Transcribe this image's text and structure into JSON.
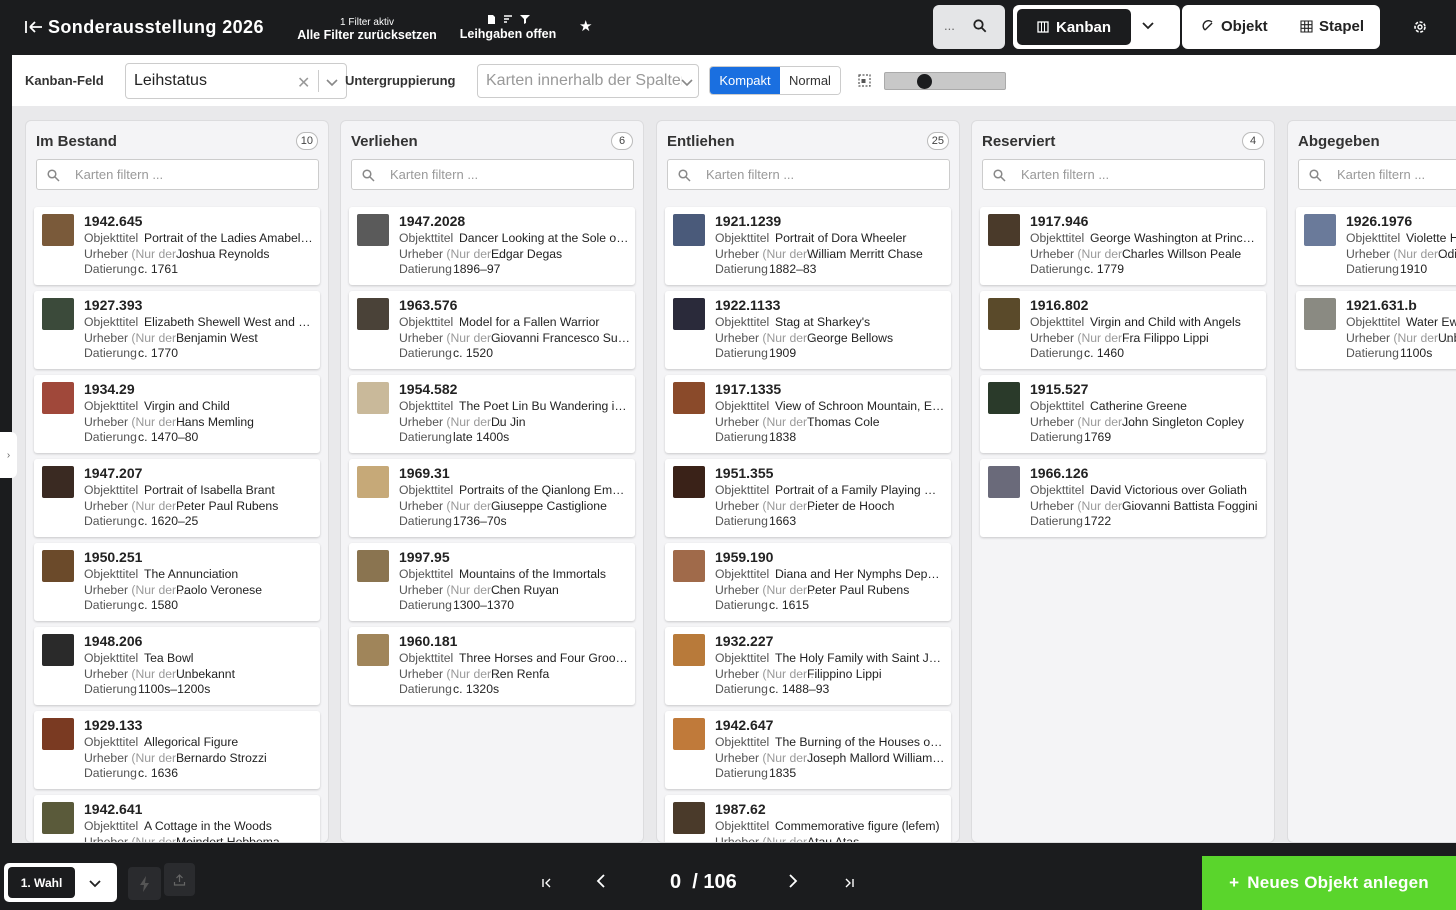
{
  "header": {
    "title": "Sonderausstellung 2026",
    "filter_status": "1 Filter aktiv",
    "filter_reset": "Alle Filter zurücksetzen",
    "lend_filter": "Leihgaben offen",
    "search_dots": "...",
    "view_label": "Kanban",
    "object_label": "Objekt",
    "stack_label": "Stapel"
  },
  "toolbar": {
    "kanban_field_label": "Kanban-Feld",
    "kanban_field_value": "Leihstatus",
    "subgroup_label": "Untergruppierung",
    "subgroup_placeholder": "Karten innerhalb der Spalten",
    "compact_label": "Kompakt",
    "normal_label": "Normal",
    "card_size_level": 0.3
  },
  "card_labels": {
    "title": "Objekttitel",
    "author": "Urheber",
    "author_note": "(Nur der ...",
    "date": "Datierung",
    "filter_placeholder": "Karten filtern ..."
  },
  "columns": [
    {
      "name": "Im Bestand",
      "count": "10",
      "cards": [
        {
          "id": "1942.645",
          "title": "Portrait of the Ladies Amabel and Mary Jemima Yorke",
          "author": "Joshua Reynolds",
          "date": "c. 1761",
          "thumb": "#7a5a3a"
        },
        {
          "id": "1927.393",
          "title": "Elizabeth Shewell West and Her Son, Raphael",
          "author": "Benjamin West",
          "date": "c. 1770",
          "thumb": "#3b4a3a"
        },
        {
          "id": "1934.29",
          "title": "Virgin and Child",
          "author": "Hans Memling",
          "date": "c. 1470–80",
          "thumb": "#a0483a"
        },
        {
          "id": "1947.207",
          "title": "Portrait of Isabella Brant",
          "author": "Peter Paul Rubens",
          "date": "c. 1620–25",
          "thumb": "#3a2a22"
        },
        {
          "id": "1950.251",
          "title": "The Annunciation",
          "author": "Paolo Veronese",
          "date": "c. 1580",
          "thumb": "#6b4a2a"
        },
        {
          "id": "1948.206",
          "title": "Tea Bowl",
          "author": "Unbekannt",
          "date": "1100s–1200s",
          "thumb": "#2a2a2a"
        },
        {
          "id": "1929.133",
          "title": "Allegorical Figure",
          "author": "Bernardo Strozzi",
          "date": "c. 1636",
          "thumb": "#7a3a22"
        },
        {
          "id": "1942.641",
          "title": "A Cottage in the Woods",
          "author": "Meindert Hobbema",
          "date": "",
          "thumb": "#5a5a3a"
        }
      ]
    },
    {
      "name": "Verliehen",
      "count": "6",
      "cards": [
        {
          "id": "1947.2028",
          "title": "Dancer Looking at the Sole of Her Right Foot",
          "author": "Edgar Degas",
          "date": "1896–97",
          "thumb": "#5a5a5a"
        },
        {
          "id": "1963.576",
          "title": "Model for a Fallen Warrior",
          "author": "Giovanni Francesco Susini",
          "date": "c. 1520",
          "thumb": "#4a4238"
        },
        {
          "id": "1954.582",
          "title": "The Poet Lin Bu Wandering in the Moonlight",
          "author": "Du Jin",
          "date": "late 1400s",
          "thumb": "#c9b99a"
        },
        {
          "id": "1969.31",
          "title": "Portraits of the Qianlong Emperor",
          "author": "Giuseppe Castiglione",
          "date": "1736–70s",
          "thumb": "#c6a978"
        },
        {
          "id": "1997.95",
          "title": "Mountains of the Immortals",
          "author": "Chen Ruyan",
          "date": "1300–1370",
          "thumb": "#8a7450"
        },
        {
          "id": "1960.181",
          "title": "Three Horses and Four Grooms",
          "author": "Ren Renfa",
          "date": "c. 1320s",
          "thumb": "#a0855a"
        }
      ]
    },
    {
      "name": "Entliehen",
      "count": "25",
      "cards": [
        {
          "id": "1921.1239",
          "title": "Portrait of Dora Wheeler",
          "author": "William Merritt Chase",
          "date": "1882–83",
          "thumb": "#4a5a7a"
        },
        {
          "id": "1922.1133",
          "title": "Stag at Sharkey's",
          "author": "George Bellows",
          "date": "1909",
          "thumb": "#2a2a3a"
        },
        {
          "id": "1917.1335",
          "title": "View of Schroon Mountain, Essex County, New York",
          "author": "Thomas Cole",
          "date": "1838",
          "thumb": "#8a4a2a"
        },
        {
          "id": "1951.355",
          "title": "Portrait of a Family Playing Music",
          "author": "Pieter de Hooch",
          "date": "1663",
          "thumb": "#3a2218"
        },
        {
          "id": "1959.190",
          "title": "Diana and Her Nymphs Departing for the Hunt",
          "author": "Peter Paul Rubens",
          "date": "c. 1615",
          "thumb": "#a06a4a"
        },
        {
          "id": "1932.227",
          "title": "The Holy Family with Saint John the Baptist",
          "author": "Filippino Lippi",
          "date": "c. 1488–93",
          "thumb": "#b87a3a"
        },
        {
          "id": "1942.647",
          "title": "The Burning of the Houses of Lords and Commons",
          "author": "Joseph Mallord William Turner",
          "date": "1835",
          "thumb": "#c07a3a"
        },
        {
          "id": "1987.62",
          "title": "Commemorative figure (lefem)",
          "author": "Atau Atas",
          "date": "",
          "thumb": "#4a3a2a"
        }
      ]
    },
    {
      "name": "Reserviert",
      "count": "4",
      "cards": [
        {
          "id": "1917.946",
          "title": "George Washington at Princeton",
          "author": "Charles Willson Peale",
          "date": "c. 1779",
          "thumb": "#4a3a2a"
        },
        {
          "id": "1916.802",
          "title": "Virgin and Child with Angels",
          "author": "Fra Filippo Lippi",
          "date": "c. 1460",
          "thumb": "#5a4a2a"
        },
        {
          "id": "1915.527",
          "title": "Catherine Greene",
          "author": "John Singleton Copley",
          "date": "1769",
          "thumb": "#2a3a2a"
        },
        {
          "id": "1966.126",
          "title": "David Victorious over Goliath",
          "author": "Giovanni Battista Foggini",
          "date": "1722",
          "thumb": "#6a6a7a"
        }
      ]
    },
    {
      "name": "Abgegeben",
      "count": "",
      "cards": [
        {
          "id": "1926.1976",
          "title": "Violette Heymann",
          "author": "Odilon Redon",
          "date": "1910",
          "thumb": "#6a7a9a"
        },
        {
          "id": "1921.631.b",
          "title": "Water Ewer",
          "author": "Unbekannt",
          "date": "1100s",
          "thumb": "#8a8a82"
        }
      ]
    }
  ],
  "footer": {
    "choice_label": "1. Wahl",
    "page_current": "0",
    "page_total": "/ 106",
    "new_object": "Neues Objekt anlegen"
  },
  "colors": {
    "accent": "#1a6fe0",
    "primary_action": "#5ad52c",
    "dark": "#1b1c1e"
  }
}
